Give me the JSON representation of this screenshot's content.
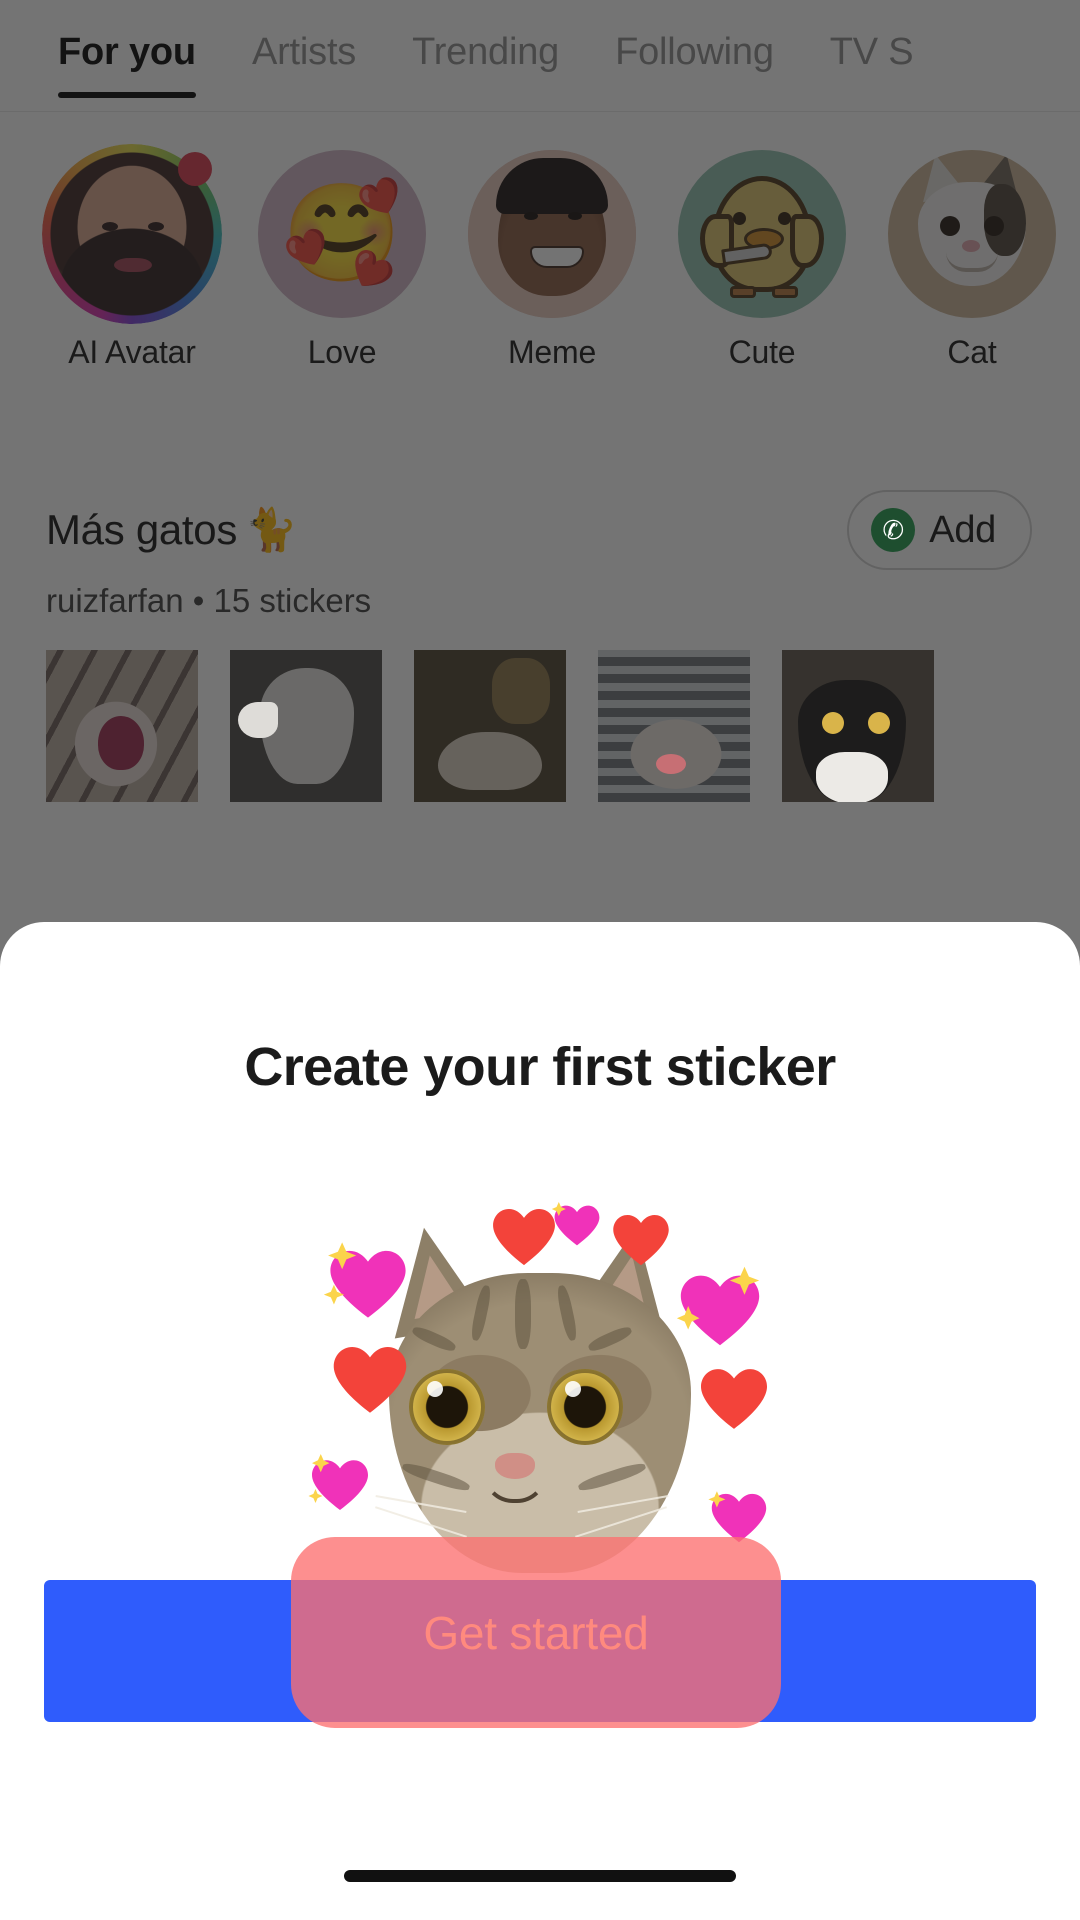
{
  "tabs": [
    {
      "label": "For you",
      "active": true
    },
    {
      "label": "Artists",
      "active": false
    },
    {
      "label": "Trending",
      "active": false
    },
    {
      "label": "Following",
      "active": false
    },
    {
      "label": "TV S",
      "active": false
    }
  ],
  "categories": [
    {
      "label": "AI Avatar",
      "icon": "ai-avatar-portrait",
      "has_badge": true,
      "ring": "rainbow-gradient",
      "bg": "#6b4f45"
    },
    {
      "label": "Love",
      "icon": "smiling-face-with-hearts-emoji",
      "has_badge": false,
      "bg": "#cfb3c4"
    },
    {
      "label": "Meme",
      "icon": "meme-face-photo",
      "has_badge": false,
      "bg": "#dcb9ae"
    },
    {
      "label": "Cute",
      "icon": "duck-with-knife-illustration",
      "has_badge": false,
      "bg": "#8fc0ad"
    },
    {
      "label": "Cat",
      "icon": "polite-cat-photo",
      "has_badge": false,
      "bg": "#cbb295"
    }
  ],
  "pack": {
    "title": "Más gatos",
    "title_emoji": "🐈",
    "author": "ruizfarfan",
    "separator": "•",
    "count_label": "15 stickers",
    "add_button_label": "Add",
    "add_button_icon": "whatsapp-icon",
    "thumbnails": [
      {
        "alt": "screaming white cat sticker"
      },
      {
        "alt": "white kitten reaching paw sticker"
      },
      {
        "alt": "cat lying on floor sticker"
      },
      {
        "alt": "cat in front of blinds sticker"
      },
      {
        "alt": "tuxedo cat staring sticker"
      }
    ]
  },
  "sheet": {
    "title": "Create your first sticker",
    "sticker_alt": "tabby cat surrounded by red and pink sparkling hearts",
    "primary_button_label": "Get started",
    "overlay_button_label": "Get started"
  },
  "colors": {
    "primary_blue": "#2F5CFC",
    "overlay_coral": "#FC7070",
    "overlay_text": "#FF8A7E",
    "whatsapp_green": "#1D9C4A",
    "badge_red": "#D9364A",
    "scrim": "rgba(30,30,30,0.62)"
  }
}
